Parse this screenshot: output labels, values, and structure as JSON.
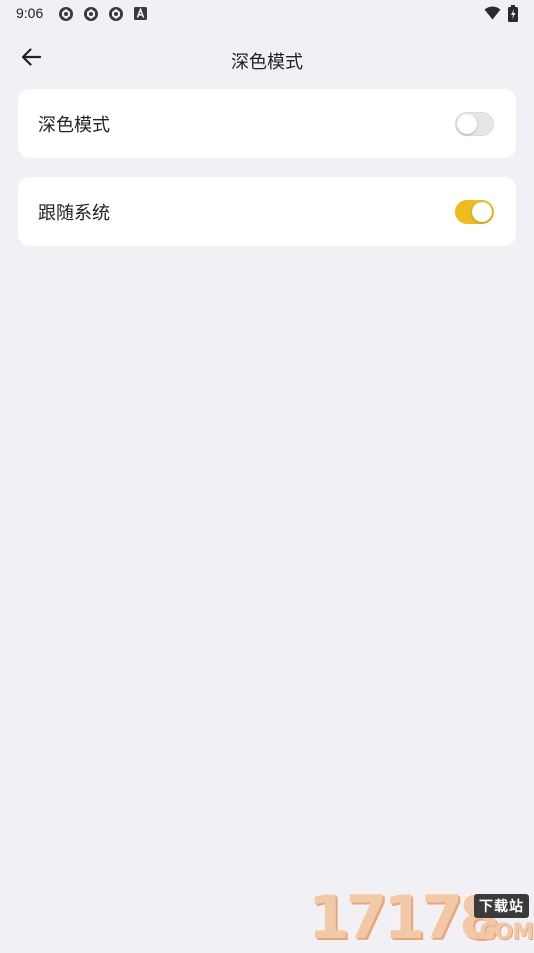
{
  "status_bar": {
    "time": "9:06",
    "notification_icons": [
      "aperture-icon",
      "aperture-icon",
      "aperture-icon",
      "a-badge-icon"
    ],
    "right_icons": [
      "wifi-icon",
      "battery-charging-icon"
    ]
  },
  "app_bar": {
    "back_icon": "arrow-left-icon",
    "title": "深色模式"
  },
  "settings": [
    {
      "label": "深色模式",
      "enabled": false
    },
    {
      "label": "跟随系统",
      "enabled": true
    }
  ],
  "colors": {
    "background": "#f1f0f5",
    "card": "#ffffff",
    "switch_on": "#eebc1f",
    "switch_off": "#e6e6e6"
  },
  "watermark": {
    "digits": "17178",
    "tag": "下载站",
    "domain": ".COM"
  }
}
